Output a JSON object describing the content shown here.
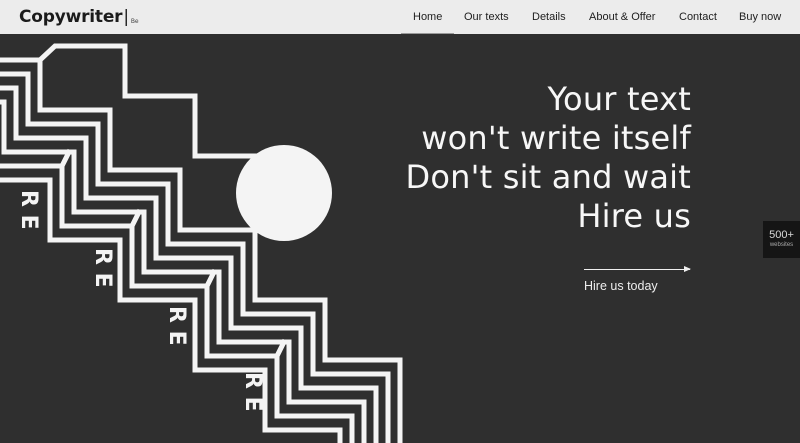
{
  "brand": {
    "name": "Copywriter",
    "suffix": "Be"
  },
  "nav": {
    "items": [
      {
        "label": "Home",
        "active": true
      },
      {
        "label": "Our texts",
        "active": false
      },
      {
        "label": "Details",
        "active": false
      },
      {
        "label": "About & Offer",
        "active": false
      },
      {
        "label": "Contact",
        "active": false
      },
      {
        "label": "Buy now",
        "active": false
      }
    ]
  },
  "hero": {
    "lines": [
      "Your text",
      "won't write itself",
      "Don't sit and wait",
      "Hire us"
    ],
    "cta_label": "Hire us today"
  },
  "badge": {
    "count": "500+",
    "label": "websites"
  },
  "colors": {
    "background": "#2f2f2f",
    "nav_background": "#ececec",
    "foreground": "#f7f7f7"
  }
}
